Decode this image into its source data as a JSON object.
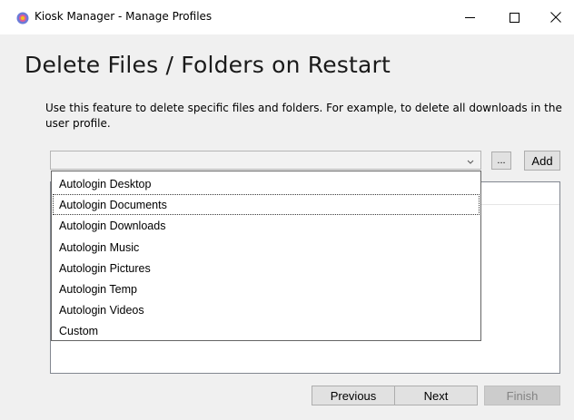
{
  "window": {
    "title": "Kiosk Manager - Manage Profiles",
    "minimize_glyph": "—",
    "maximize_glyph": "☐",
    "close_glyph": "✕"
  },
  "page": {
    "heading": "Delete Files / Folders on Restart",
    "description": "Use this feature to delete specific files and folders.  For example, to delete all downloads in the user profile."
  },
  "path_combo": {
    "value": "",
    "browse_label": "...",
    "add_label": "Add"
  },
  "dropdown": {
    "items": [
      "Autologin Desktop",
      "Autologin Documents",
      "Autologin Downloads",
      "Autologin Music",
      "Autologin Pictures",
      "Autologin Temp",
      "Autologin Videos",
      "Custom"
    ],
    "selected_index": 1
  },
  "footer": {
    "previous_label": "Previous",
    "next_label": "Next",
    "finish_label": "Finish"
  },
  "colors": {
    "app_icon_outer": "#6b7bd8",
    "app_icon_inner": "#f0c020",
    "finish_disabled_text": "#838383"
  }
}
